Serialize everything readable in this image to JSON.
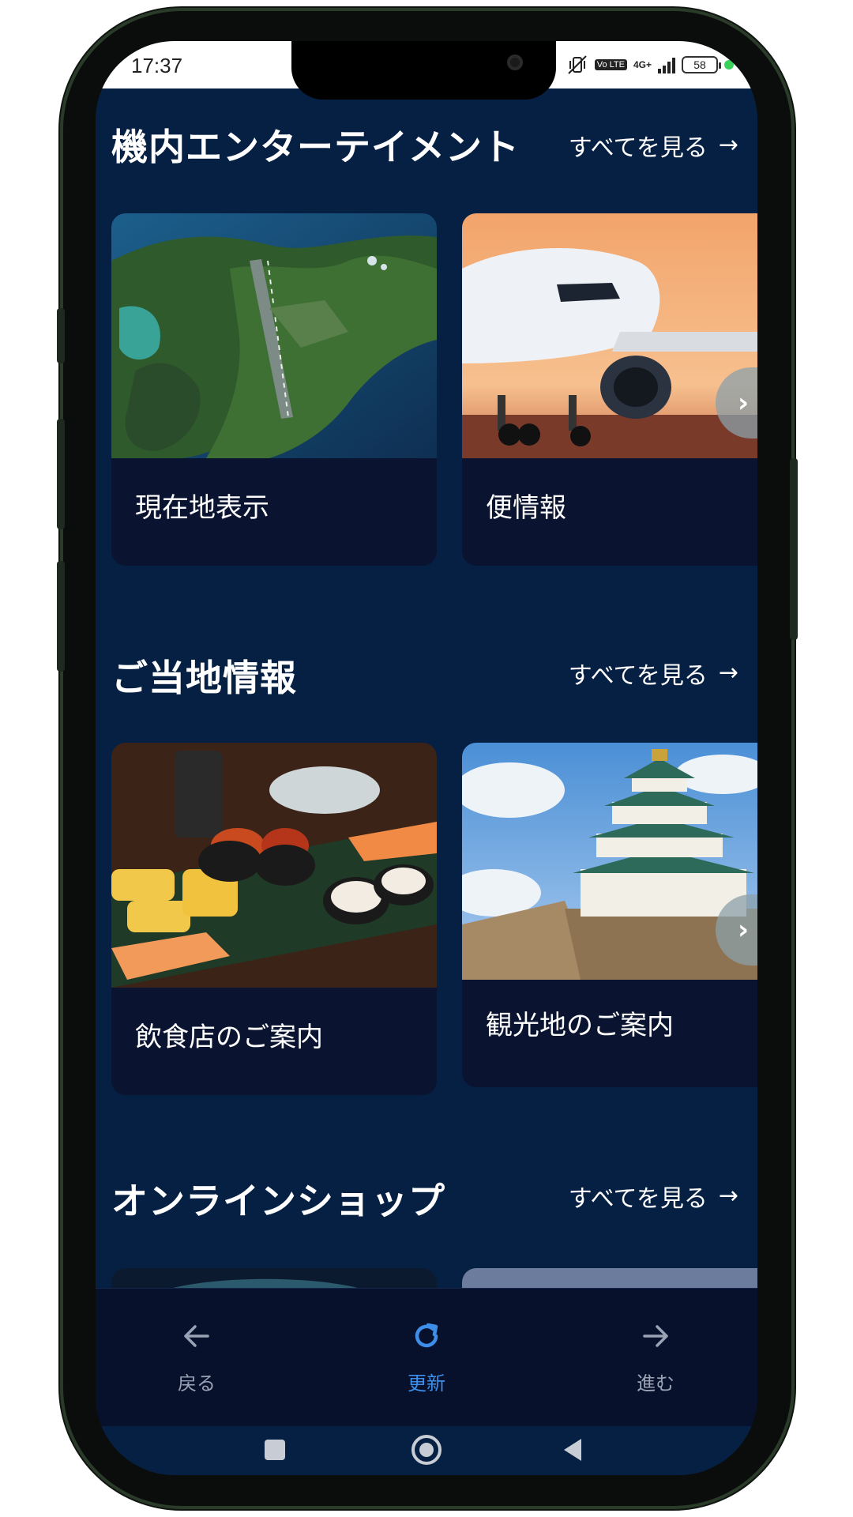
{
  "status_bar": {
    "time": "17:37",
    "network": "4G+",
    "volte": "Vo LTE",
    "battery": "58"
  },
  "sections": [
    {
      "title": "機内エンターテイメント",
      "see_all": "すべてを見る",
      "cards": [
        {
          "label": "現在地表示",
          "image": "aerial-airport-island"
        },
        {
          "label": "便情報",
          "image": "airplane-at-sunset"
        }
      ]
    },
    {
      "title": "ご当地情報",
      "see_all": "すべてを見る",
      "cards": [
        {
          "label": "飲食店のご案内",
          "image": "sushi-platter"
        },
        {
          "label": "観光地のご案内",
          "image": "osaka-castle"
        }
      ]
    },
    {
      "title": "オンラインショップ",
      "see_all": "すべてを見る",
      "cards": []
    }
  ],
  "bottom_nav": {
    "back": "戻る",
    "refresh": "更新",
    "forward": "進む"
  },
  "colors": {
    "background": "#062044",
    "card": "#0a1430",
    "nav_bg": "#08112b",
    "accent": "#3d8ee8",
    "nav_inactive": "#9aa3b5"
  },
  "icons": {
    "back": "arrow-left-icon",
    "refresh": "refresh-icon",
    "forward": "arrow-right-icon",
    "see_all": "arrow-right-icon",
    "carousel_next": "chevron-right-icon",
    "android_recents": "square-icon",
    "android_home": "circle-icon",
    "android_back": "triangle-back-icon"
  }
}
